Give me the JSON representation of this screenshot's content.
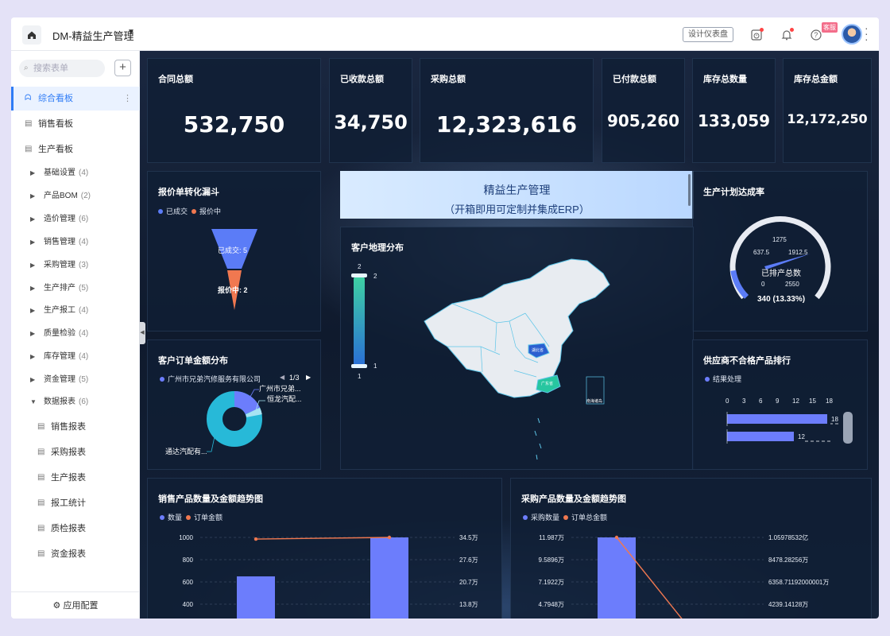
{
  "topbar": {
    "title": "DM-精益生产管理",
    "design_button": "设计仪表盘",
    "kefu": "客服"
  },
  "sidebar": {
    "search_placeholder": "搜索表单",
    "top_items": [
      {
        "label": "综合看板",
        "icon": "chart-icon",
        "active": true
      },
      {
        "label": "销售看板",
        "icon": "form-icon"
      },
      {
        "label": "生产看板",
        "icon": "form-icon"
      }
    ],
    "groups": [
      {
        "label": "基础设置",
        "count": "(4)"
      },
      {
        "label": "产品BOM",
        "count": "(2)"
      },
      {
        "label": "造价管理",
        "count": "(6)"
      },
      {
        "label": "销售管理",
        "count": "(4)"
      },
      {
        "label": "采购管理",
        "count": "(3)"
      },
      {
        "label": "生产排产",
        "count": "(5)"
      },
      {
        "label": "生产报工",
        "count": "(4)"
      },
      {
        "label": "质量检验",
        "count": "(4)"
      },
      {
        "label": "库存管理",
        "count": "(4)"
      },
      {
        "label": "资金管理",
        "count": "(5)"
      },
      {
        "label": "数据报表",
        "count": "(6)",
        "expanded": true
      }
    ],
    "sub_items": [
      "销售报表",
      "采购报表",
      "生产报表",
      "报工统计",
      "质检报表",
      "资金报表"
    ],
    "footer": "应用配置"
  },
  "kpis": [
    {
      "label": "合同总额",
      "value": "532,750"
    },
    {
      "label": "已收款总额",
      "value": "34,750"
    },
    {
      "label": "采购总额",
      "value": "12,323,616"
    },
    {
      "label": "已付款总额",
      "value": "905,260"
    },
    {
      "label": "库存总数量",
      "value": "133,059"
    },
    {
      "label": "库存总金额",
      "value": "12,172,250"
    }
  ],
  "funnel": {
    "title": "报价单转化漏斗",
    "legend": [
      "已成交",
      "报价中"
    ],
    "labels": [
      "已成交: 5",
      "报价中: 2"
    ],
    "colors": [
      "#5b7cf7",
      "#f07850"
    ]
  },
  "banner": {
    "line1": "精益生产管理",
    "line2": "（开箱即用可定制并集成ERP）"
  },
  "gauge": {
    "title": "生产计划达成率",
    "ticks": [
      "0",
      "637.5",
      "1275",
      "1912.5",
      "2550"
    ],
    "center_label": "已排产总数",
    "value_label": "340 (13.33%)",
    "value": 340,
    "max": 2550
  },
  "order_amount": {
    "title": "客户订单金额分布",
    "legend_item": "广州市兄弟汽修服务有限公司",
    "pager": "1/3",
    "labels": [
      "广州市兄弟...",
      "恒龙汽配...",
      "通达汽配有..."
    ]
  },
  "map": {
    "title": "客户地理分布",
    "scale_top": "2",
    "scale_bottom": "1",
    "scale_top_right": "2",
    "scale_bottom_right": "1",
    "tag_hubei": "湖北省",
    "tag_guangdong": "广东省",
    "tag_nanhai": "南海诸岛"
  },
  "supplier": {
    "title": "供应商不合格产品排行",
    "legend": "结果处理",
    "axis": [
      "0",
      "3",
      "6",
      "9",
      "12",
      "15",
      "18"
    ]
  },
  "chart_data": [
    {
      "type": "bar",
      "title": "供应商不合格产品排行",
      "series": [
        {
          "name": "结果处理",
          "values": [
            18,
            12
          ]
        }
      ],
      "xlim": [
        0,
        18
      ]
    },
    {
      "type": "bar",
      "title": "销售产品数量及金额趋势图",
      "series": [
        {
          "name": "数量",
          "type": "bar",
          "values": [
            650,
            1000
          ]
        },
        {
          "name": "订单金额",
          "type": "line",
          "values": [
            34,
            34.5
          ]
        }
      ],
      "y_left_ticks": [
        "1000",
        "800",
        "600",
        "400"
      ],
      "y_right_ticks": [
        "34.5万",
        "27.6万",
        "20.7万",
        "13.8万"
      ]
    },
    {
      "type": "bar",
      "title": "采购产品数量及金额趋势图",
      "series": [
        {
          "name": "采购数量",
          "type": "bar",
          "values": [
            11.987
          ]
        },
        {
          "name": "订单总金额",
          "type": "line",
          "values": [
            10597.8532
          ]
        }
      ],
      "y_left_ticks": [
        "11.987万",
        "9.5896万",
        "7.1922万",
        "4.7948万"
      ],
      "y_right_ticks": [
        "1.05978532亿",
        "8478.28256万",
        "6358.71192000001万",
        "4239.14128万"
      ]
    }
  ],
  "sales_trend": {
    "title": "销售产品数量及金额趋势图",
    "legend": [
      "数量",
      "订单金额"
    ]
  },
  "purchase_trend": {
    "title": "采购产品数量及金额趋势图",
    "legend": [
      "采购数量",
      "订单总金额"
    ]
  },
  "colors": {
    "accent": "#2f7cf6",
    "bar": "#6c7dfc",
    "line": "#f07850",
    "teal": "#27b9d8"
  }
}
